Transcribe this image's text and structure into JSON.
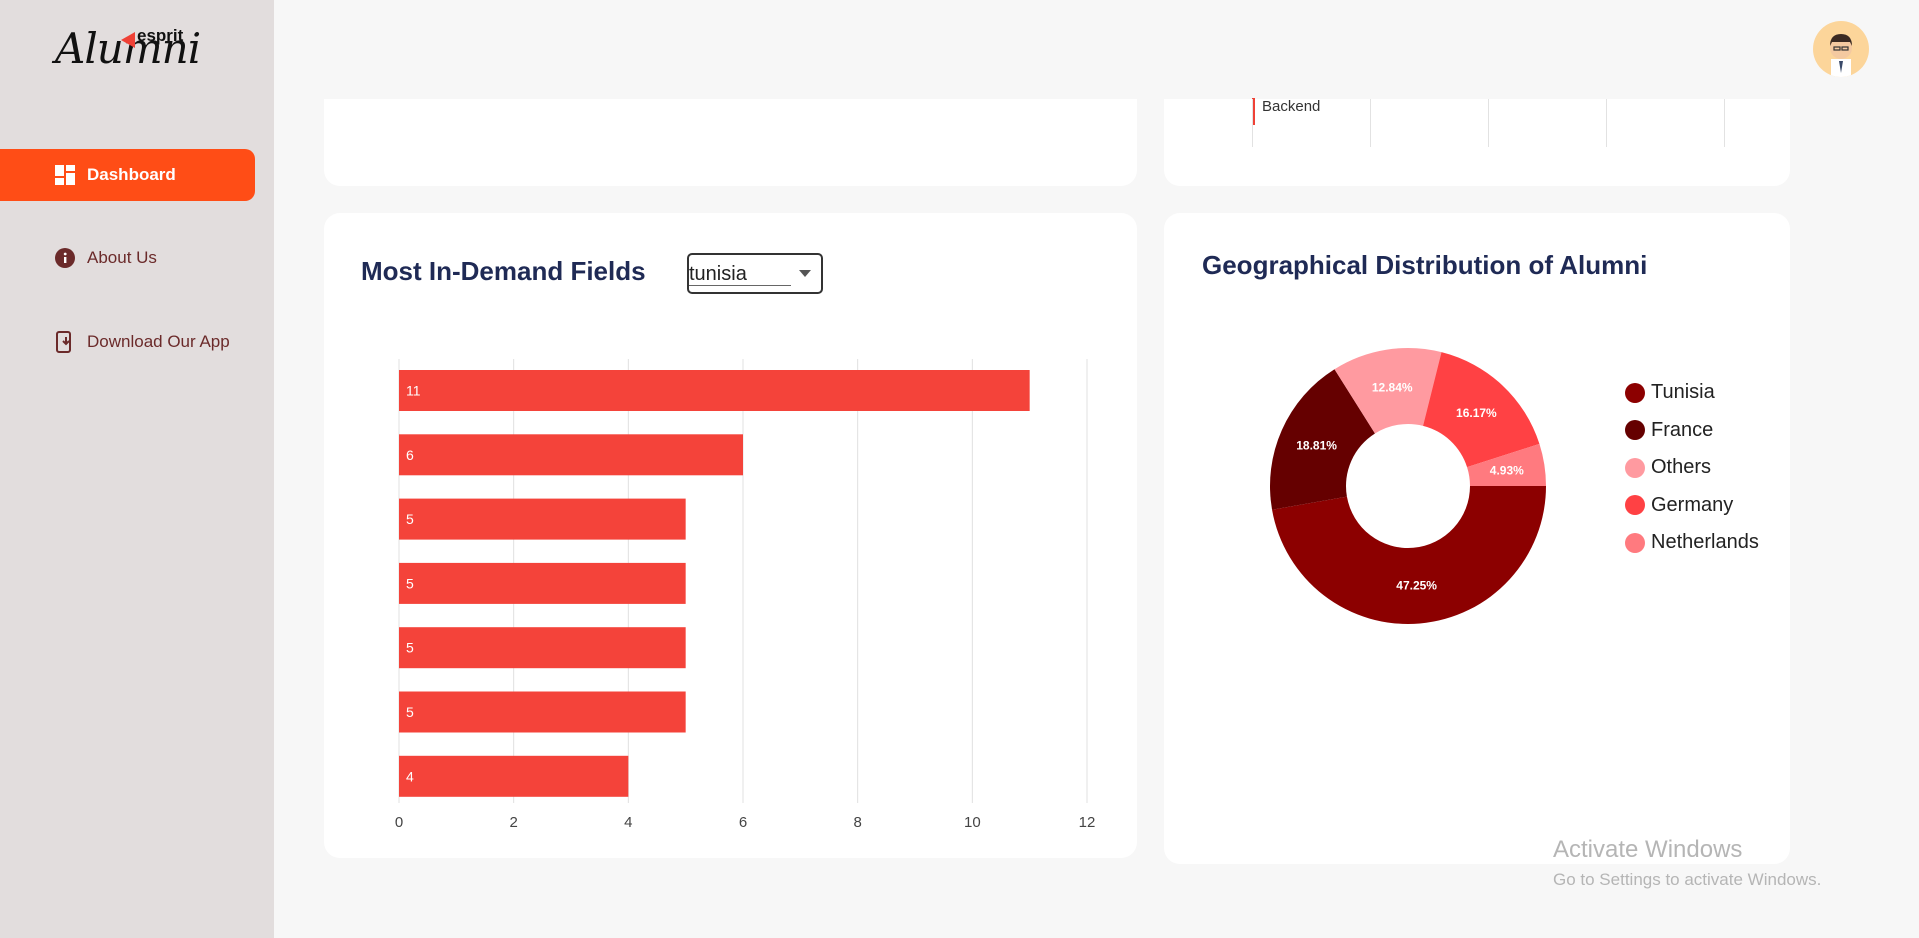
{
  "app": {
    "logo_text": "Alumni",
    "logo_subtext": "esprit"
  },
  "sidebar": {
    "items": [
      {
        "label": "Dashboard",
        "icon": "dashboard-icon",
        "active": true
      },
      {
        "label": "About Us",
        "icon": "info-icon",
        "active": false
      },
      {
        "label": "Download Our App",
        "icon": "download-app-icon",
        "active": false
      }
    ]
  },
  "header": {
    "avatar_icon": "user-avatar-icon"
  },
  "top_card": {
    "legend_label": "Backend"
  },
  "demand_card": {
    "title": "Most In-Demand Fields",
    "country_select_value": "tunisia"
  },
  "geo_card": {
    "title": "Geographical Distribution of Alumni"
  },
  "watermark": {
    "line1": "Activate Windows",
    "line2": "Go to Settings to activate Windows."
  },
  "colors": {
    "accent": "#ff4d16",
    "bar": "#f4433a",
    "title": "#1f2a55"
  },
  "chart_data": [
    {
      "type": "bar",
      "orientation": "horizontal",
      "values": [
        11,
        6,
        5,
        5,
        5,
        5,
        4
      ],
      "x_ticks": [
        "0",
        "2",
        "4",
        "6",
        "8",
        "10",
        "12"
      ],
      "xlim": [
        0,
        12
      ],
      "grid": true,
      "color": "#f4433a"
    },
    {
      "type": "pie",
      "donut": true,
      "legend_position": "right",
      "slices": [
        {
          "label": "Tunisia",
          "value": 47.25,
          "display": "47.25%",
          "color": "#8c0000"
        },
        {
          "label": "France",
          "value": 18.81,
          "display": "18.81%",
          "color": "#650000"
        },
        {
          "label": "Others",
          "value": 12.84,
          "display": "12.84%",
          "color": "#ff9aa0"
        },
        {
          "label": "Germany",
          "value": 16.17,
          "display": "16.17%",
          "color": "#ff4144"
        },
        {
          "label": "Netherlands",
          "value": 4.93,
          "display": "4.93%",
          "color": "#ff7a7f"
        }
      ]
    }
  ]
}
